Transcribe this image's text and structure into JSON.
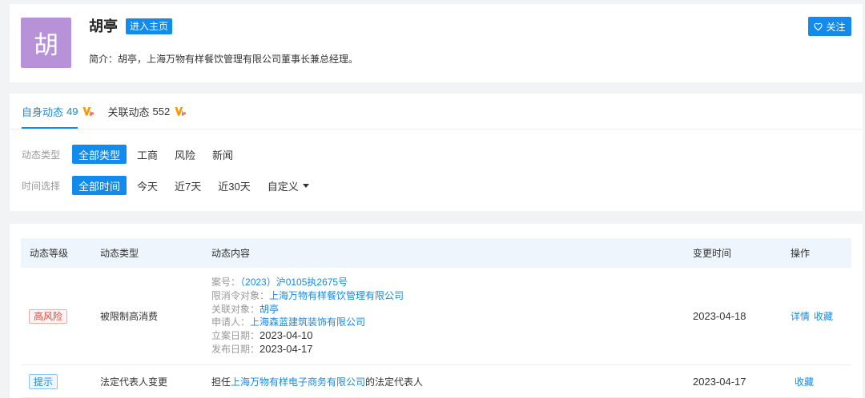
{
  "theme": {
    "brand_blue": "#128bed",
    "text_dark": "#333333",
    "text_gray": "#999999",
    "page_bg": "#f2f3f5",
    "card_bg": "#ffffff",
    "avatar_bg": "#b892d8",
    "risk_red": "#f04134",
    "table_header_bg": "#eef5fc",
    "vip_orange": "#ff9600",
    "vip_red": "#e8452c",
    "divider": "#eeeeee"
  },
  "profile": {
    "avatar_char": "胡",
    "name": "胡亭",
    "home_button": "进入主页",
    "intro": "简介：胡亭，上海万物有样餐饮管理有限公司董事长兼总经理。",
    "follow": {
      "icon": "heart-outline-icon",
      "label": "关注"
    }
  },
  "tabs": [
    {
      "label": "自身动态",
      "count": 49,
      "icon": "vip-icon",
      "active": true
    },
    {
      "label": "关联动态",
      "count": 552,
      "icon": "vip-icon",
      "active": false
    }
  ],
  "filters": {
    "type": {
      "label": "动态类型",
      "options": [
        {
          "label": "全部类型",
          "active": true
        },
        {
          "label": "工商",
          "active": false
        },
        {
          "label": "风险",
          "active": false
        },
        {
          "label": "新闻",
          "active": false
        }
      ]
    },
    "time": {
      "label": "时间选择",
      "options": [
        {
          "label": "全部时间",
          "active": true
        },
        {
          "label": "今天",
          "active": false
        },
        {
          "label": "近7天",
          "active": false
        },
        {
          "label": "近30天",
          "active": false
        },
        {
          "label": "自定义",
          "active": false,
          "icon": "caret-down-icon"
        }
      ]
    }
  },
  "table": {
    "columns": [
      "动态等级",
      "动态类型",
      "动态内容",
      "变更时间",
      "操作"
    ],
    "rows": [
      {
        "level": "高风险",
        "level_color": "#f04134",
        "type": "被限制高消费",
        "details": [
          {
            "label": "案号：",
            "value": "（2023）沪0105执2675号",
            "link": true
          },
          {
            "label": "限消令对象：",
            "value": "上海万物有样餐饮管理有限公司",
            "link": true
          },
          {
            "label": "关联对象：",
            "value": "胡亭",
            "link": true
          },
          {
            "label": "申请人：",
            "value": "上海森蓝建筑装饰有限公司",
            "link": true
          },
          {
            "label": "立案日期：",
            "value": "2023-04-10",
            "link": false
          },
          {
            "label": "发布日期：",
            "value": "2023-04-17",
            "link": false
          }
        ],
        "date": "2023-04-18",
        "actions": [
          "详情",
          "收藏"
        ]
      },
      {
        "level": "提示",
        "level_color": "#128bed",
        "type": "法定代表人变更",
        "summary": [
          {
            "text": "担任",
            "link": false
          },
          {
            "text": "上海万物有样电子商务有限公司",
            "link": true
          },
          {
            "text": "的法定代表人",
            "link": false
          }
        ],
        "date": "2023-04-17",
        "actions": [
          "收藏"
        ]
      }
    ]
  }
}
